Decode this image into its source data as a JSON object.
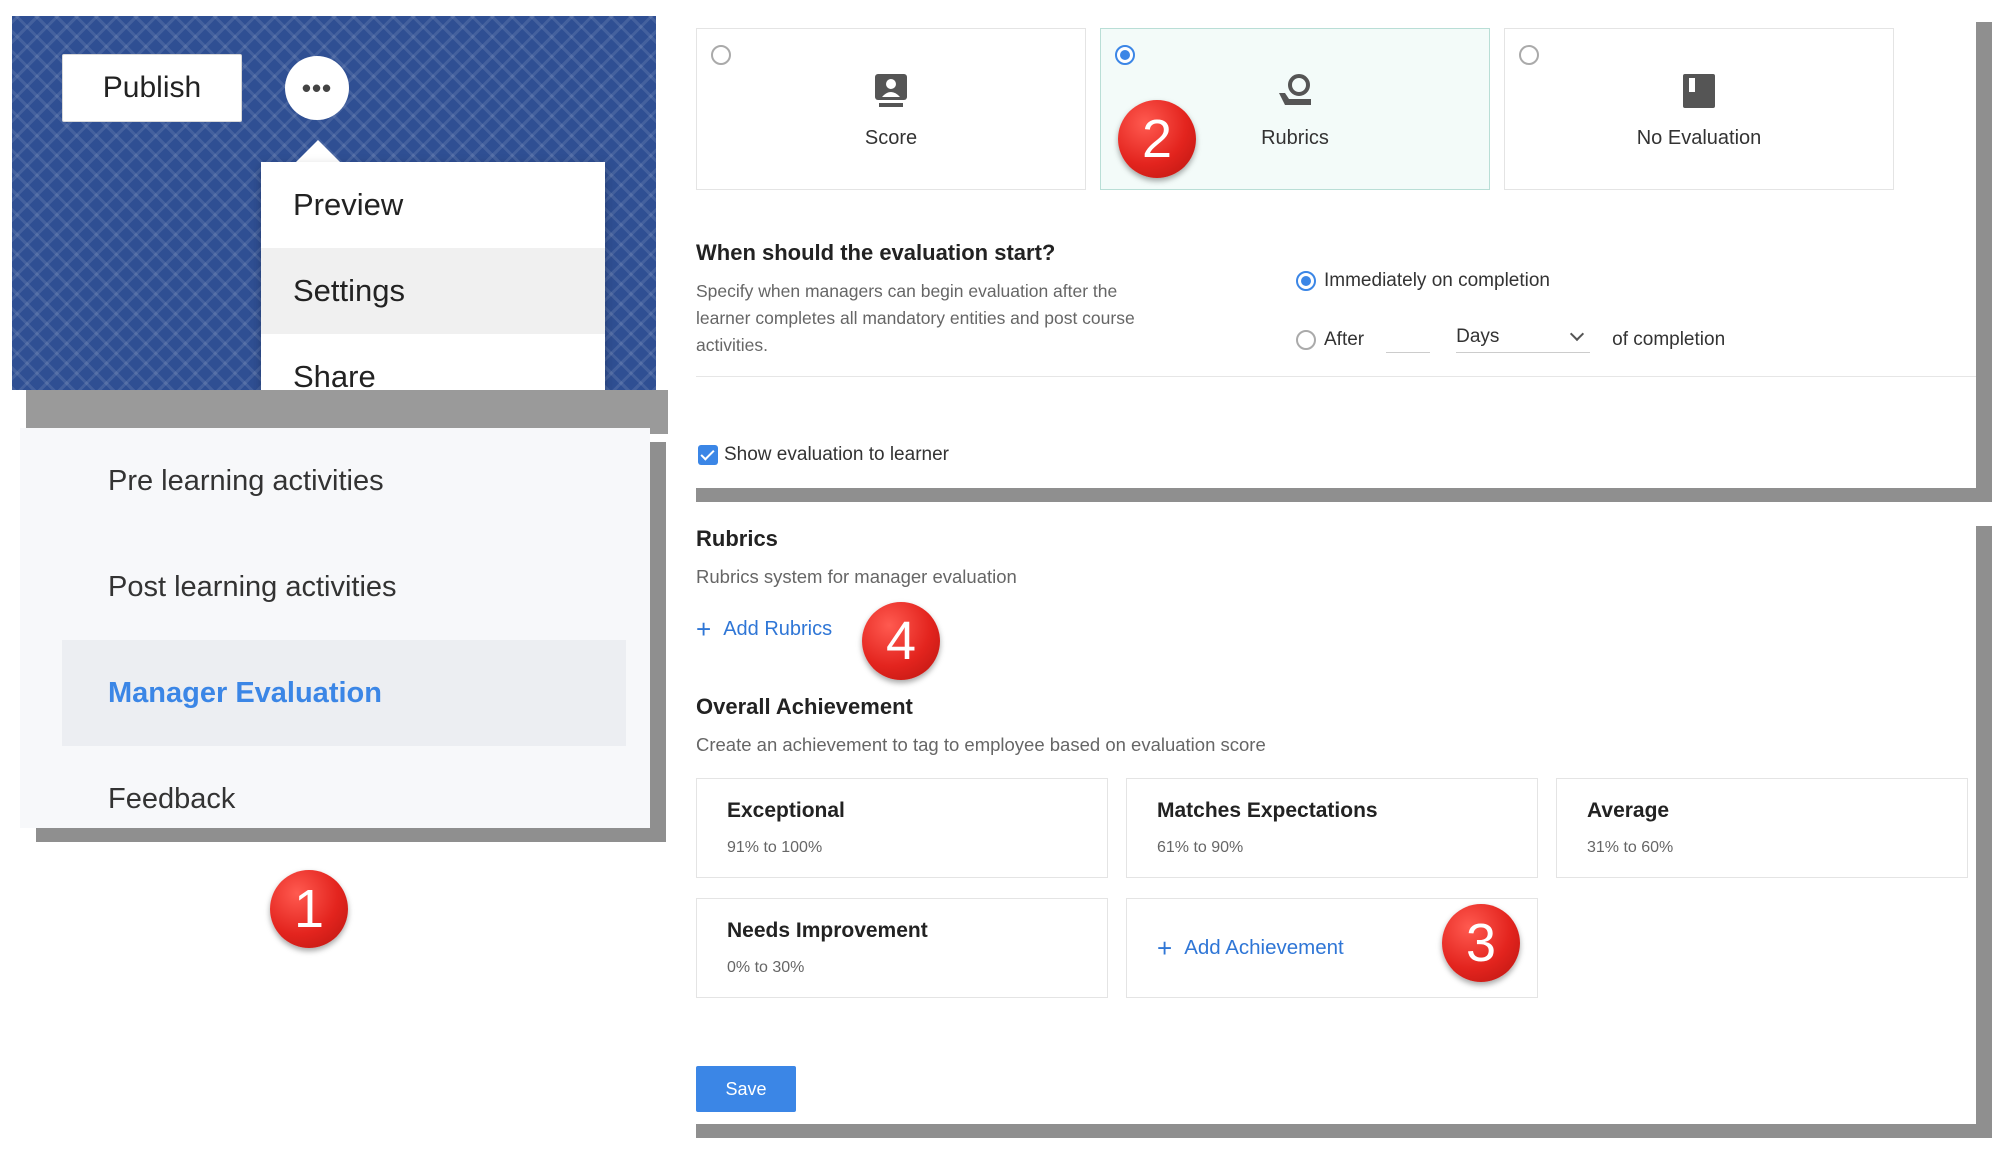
{
  "header": {
    "publish_label": "Publish",
    "more_icon": "more-horizontal-icon",
    "menu": [
      {
        "label": "Preview"
      },
      {
        "label": "Settings"
      },
      {
        "label": "Share"
      }
    ]
  },
  "nav": {
    "items": [
      {
        "label": "Pre learning activities"
      },
      {
        "label": "Post learning activities"
      },
      {
        "label": "Manager Evaluation"
      },
      {
        "label": "Feedback"
      }
    ]
  },
  "badges": [
    "1",
    "2",
    "3",
    "4"
  ],
  "evaluation_type": {
    "options": [
      {
        "label": "Score",
        "icon": "score-icon"
      },
      {
        "label": "Rubrics",
        "icon": "rubrics-icon"
      },
      {
        "label": "No Evaluation",
        "icon": "no-evaluation-icon"
      }
    ]
  },
  "start": {
    "title": "When should the evaluation start?",
    "description": "Specify when managers can begin evaluation after the learner completes all mandatory entities and post course activities.",
    "immediately_label": "Immediately on completion",
    "after_label": "After",
    "days_value": "Days",
    "suffix": "of completion"
  },
  "show_eval_label": "Show evaluation to learner",
  "rubrics": {
    "title": "Rubrics",
    "description": "Rubrics system for manager evaluation",
    "add_label": "Add Rubrics"
  },
  "achievement": {
    "title": "Overall Achievement",
    "description": "Create an achievement to tag to employee based on evaluation score",
    "items": [
      {
        "name": "Exceptional",
        "range": "91% to 100%"
      },
      {
        "name": "Matches Expectations",
        "range": "61% to 90%"
      },
      {
        "name": "Average",
        "range": "31% to 60%"
      },
      {
        "name": "Needs Improvement",
        "range": "0% to 30%"
      }
    ],
    "add_label": "Add Achievement"
  },
  "save_label": "Save",
  "colors": {
    "accent": "#3b86e6",
    "badge": "#e3241e",
    "header_bg": "#2f4f93"
  }
}
